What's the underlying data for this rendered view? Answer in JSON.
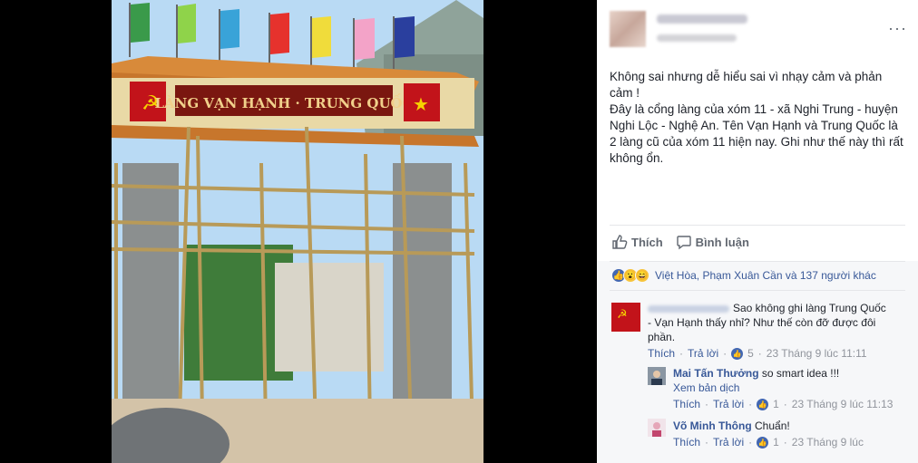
{
  "post": {
    "text_lines": [
      "Không sai nhưng dễ hiểu sai vì nhạy cảm và phản cảm !",
      "Đây là cổng làng của xóm 11 - xã Nghi Trung - huyện Nghi Lộc - Nghệ An. Tên Vạn Hạnh và Trung Quốc là 2 làng cũ của xóm 11 hiện nay. Ghi như thế này thì rất không ổn."
    ],
    "photo_sign": "LÀNG VẠN HẠNH - TRUNG QUỐC"
  },
  "actions": {
    "like_label": "Thích",
    "comment_label": "Bình luận"
  },
  "reactions": {
    "summary": "Việt Hòa, Phạm Xuân Cần và 137 người khác"
  },
  "comments": [
    {
      "text_line1": "Sao không ghi làng Trung Quốc",
      "text_line2": "- Vạn Hạnh thấy nhỉ? Như thế còn đỡ được đôi",
      "text_line3": "phần.",
      "like": "Thích",
      "reply": "Trả lời",
      "likes": "5",
      "time": "23 Tháng 9 lúc 11:11"
    },
    {
      "name": "Mai Tấn Thưởng",
      "text": "so smart idea !!!",
      "see_translation": "Xem bản dịch",
      "like": "Thích",
      "reply": "Trả lời",
      "likes": "1",
      "time": "23 Tháng 9 lúc 11:13"
    },
    {
      "name": "Võ Minh Thông",
      "text": "Chuẩn!",
      "like": "Thích",
      "reply": "Trả lời",
      "likes": "1",
      "time": "23 Tháng 9 lúc"
    }
  ],
  "icons": {
    "more": "more-options-icon",
    "like": "thumbs-up-icon",
    "comment": "comment-bubble-icon"
  },
  "colors": {
    "link": "#385898",
    "muted": "#90949c",
    "like_blue": "#4267b2"
  }
}
